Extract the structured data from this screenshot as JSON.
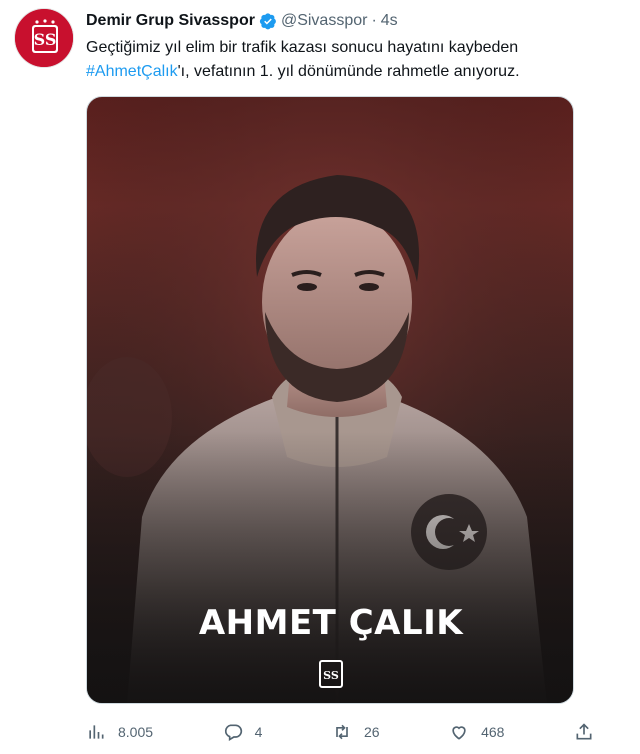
{
  "account": {
    "display_name": "Demir Grup Sivasspor",
    "handle": "@Sivasspor",
    "separator": "·",
    "time": "4s"
  },
  "tweet": {
    "text_part1": "Geçtiğimiz yıl elim bir trafik kazası sonucu hayatını kaybeden ",
    "hashtag": "#AhmetÇalık",
    "text_part2": "'ı, vefatının 1. yıl dönümünde rahmetle anıyoruz."
  },
  "media": {
    "overlay_name": "AHMET ÇALIK"
  },
  "actions": {
    "views": "8.005",
    "replies": "4",
    "retweets": "26",
    "likes": "468"
  },
  "colors": {
    "link": "#1d9bf0",
    "muted": "#536471",
    "verified": "#1d9bf0",
    "club_red": "#c8102e"
  },
  "icons": [
    "club-logo-avatar",
    "verified-badge-icon",
    "views-icon",
    "reply-icon",
    "retweet-icon",
    "like-icon",
    "share-icon",
    "club-logo-icon"
  ]
}
